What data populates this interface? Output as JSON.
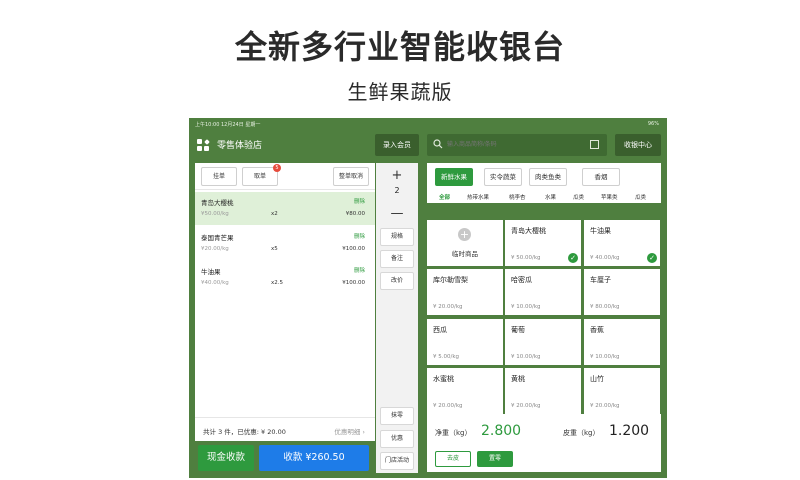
{
  "promo": {
    "title": "全新多行业智能收银台",
    "subtitle": "生鲜果蔬版"
  },
  "status_bar": {
    "left": "上午10:00  12月24日  星期一",
    "right": "96%"
  },
  "header": {
    "store_name": "零售体验店",
    "member_button": "录入会员",
    "search_placeholder": "输入商品简称/条码",
    "cashier_center": "收银中心"
  },
  "order_toolbar": {
    "hold": "挂单",
    "retrieve": "取单",
    "retrieve_badge": "5",
    "clear": "整单取消"
  },
  "order_items": [
    {
      "name": "青岛大樱桃",
      "action": "删除",
      "price": "¥50.00/kg",
      "qty": "x2",
      "subtotal": "¥80.00"
    },
    {
      "name": "泰国青芒果",
      "action": "删除",
      "price": "¥20.00/kg",
      "qty": "x5",
      "subtotal": "¥100.00"
    },
    {
      "name": "牛油果",
      "action": "删除",
      "price": "¥40.00/kg",
      "qty": "x2.5",
      "subtotal": "¥100.00"
    }
  ],
  "actions": {
    "plus": "+",
    "qty": "2",
    "minus": "—",
    "spec": "规格",
    "note": "备注",
    "reprice": "改价",
    "round": "抹零",
    "discount": "优惠",
    "promo": "门店活动"
  },
  "summary": {
    "text": "共计 3 件，已优惠: ¥ 20.00",
    "detail_link": "优惠明细 ›"
  },
  "payment": {
    "cash": "现金收款",
    "checkout": "收款 ¥260.50"
  },
  "categories": [
    "新鲜水果",
    "实令蔬菜",
    "肉类鱼类",
    "香烟"
  ],
  "subcategories": [
    "全部",
    "热带水果",
    "桃李杏",
    "水果",
    "瓜类",
    "苹果类",
    "瓜类"
  ],
  "temp_product": {
    "label": "临时商品"
  },
  "products": [
    {
      "name": "青岛大樱桃",
      "price": "¥ 50.00/kg",
      "selected": true
    },
    {
      "name": "牛油果",
      "price": "¥ 40.00/kg",
      "selected": true
    },
    {
      "name": "库尔勒雪梨",
      "price": "¥ 20.00/kg",
      "selected": false
    },
    {
      "name": "哈密瓜",
      "price": "¥ 10.00/kg",
      "selected": false
    },
    {
      "name": "车厘子",
      "price": "¥ 80.00/kg",
      "selected": false
    },
    {
      "name": "西瓜",
      "price": "¥ 5.00/kg",
      "selected": false
    },
    {
      "name": "葡萄",
      "price": "¥ 10.00/kg",
      "selected": false
    },
    {
      "name": "香蕉",
      "price": "¥ 10.00/kg",
      "selected": false
    },
    {
      "name": "水蜜桃",
      "price": "¥ 20.00/kg",
      "selected": false
    },
    {
      "name": "黄桃",
      "price": "¥ 20.00/kg",
      "selected": false
    },
    {
      "name": "山竹",
      "price": "¥ 20.00/kg",
      "selected": false
    }
  ],
  "weight": {
    "net_label": "净重（kg）",
    "net_value": "2.800",
    "tare_label": "皮重（kg）",
    "tare_value": "1.200",
    "remove_tare": "去皮",
    "zero": "置零"
  },
  "colors": {
    "frame_green": "#4f7f3f",
    "accent_green": "#2e9a3e",
    "pay_blue": "#1e7ce8",
    "badge_red": "#e64b3c"
  }
}
